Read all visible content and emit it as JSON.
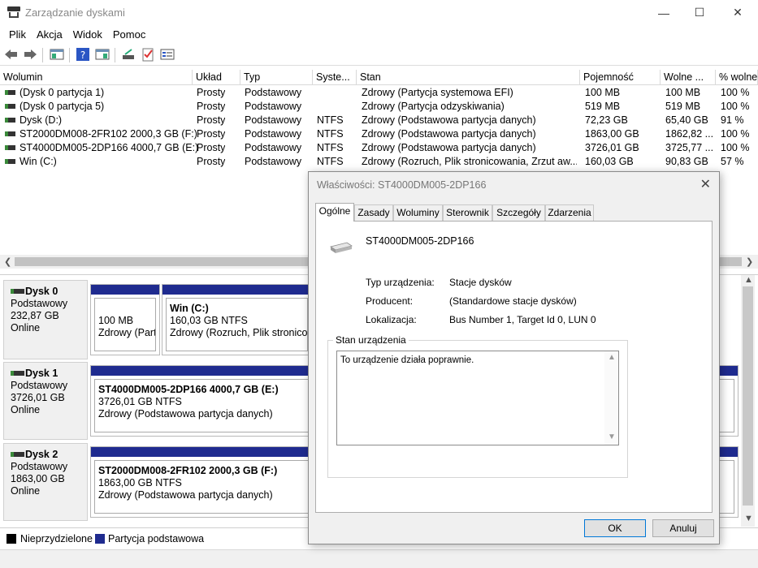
{
  "window": {
    "title": "Zarządzanie dyskami"
  },
  "menu": [
    "Plik",
    "Akcja",
    "Widok",
    "Pomoc"
  ],
  "volumes": {
    "columns": [
      "Wolumin",
      "Układ",
      "Typ",
      "Syste...",
      "Stan",
      "Pojemność",
      "Wolne ...",
      "% wolne"
    ],
    "rows": [
      [
        "(Dysk 0 partycja 1)",
        "Prosty",
        "Podstawowy",
        "",
        "Zdrowy (Partycja systemowa EFI)",
        "100 MB",
        "100 MB",
        "100 %"
      ],
      [
        "(Dysk 0 partycja 5)",
        "Prosty",
        "Podstawowy",
        "",
        "Zdrowy (Partycja odzyskiwania)",
        "519 MB",
        "519 MB",
        "100 %"
      ],
      [
        "Dysk (D:)",
        "Prosty",
        "Podstawowy",
        "NTFS",
        "Zdrowy (Podstawowa partycja danych)",
        "72,23 GB",
        "65,40 GB",
        "91 %"
      ],
      [
        "ST2000DM008-2FR102 2000,3 GB (F:)",
        "Prosty",
        "Podstawowy",
        "NTFS",
        "Zdrowy (Podstawowa partycja danych)",
        "1863,00 GB",
        "1862,82 ...",
        "100 %"
      ],
      [
        "ST4000DM005-2DP166 4000,7 GB (E:)",
        "Prosty",
        "Podstawowy",
        "NTFS",
        "Zdrowy (Podstawowa partycja danych)",
        "3726,01 GB",
        "3725,77 ...",
        "100 %"
      ],
      [
        "Win (C:)",
        "Prosty",
        "Podstawowy",
        "NTFS",
        "Zdrowy (Rozruch, Plik stronicowania, Zrzut aw...",
        "160,03 GB",
        "90,83 GB",
        "57 %"
      ]
    ]
  },
  "disks": [
    {
      "name": "Dysk 0",
      "type": "Podstawowy",
      "size": "232,87 GB",
      "status": "Online",
      "partitions": [
        {
          "title": "",
          "line1": "100 MB",
          "line2": "Zdrowy (Part"
        },
        {
          "title": "Win  (C:)",
          "line1": "160,03 GB NTFS",
          "line2": "Zdrowy (Rozruch, Plik stronicow"
        }
      ]
    },
    {
      "name": "Dysk 1",
      "type": "Podstawowy",
      "size": "3726,01 GB",
      "status": "Online",
      "partitions": [
        {
          "title": "ST4000DM005-2DP166 4000,7 GB  (E:)",
          "line1": "3726,01 GB NTFS",
          "line2": "Zdrowy (Podstawowa partycja danych)"
        }
      ]
    },
    {
      "name": "Dysk 2",
      "type": "Podstawowy",
      "size": "1863,00 GB",
      "status": "Online",
      "partitions": [
        {
          "title": "ST2000DM008-2FR102 2000,3 GB  (F:)",
          "line1": "1863,00 GB NTFS",
          "line2": "Zdrowy (Podstawowa partycja danych)"
        }
      ]
    }
  ],
  "legend": {
    "unallocated": "Nieprzydzielone",
    "primary": "Partycja podstawowa",
    "unallocated_color": "#000000",
    "primary_color": "#1f2b8f"
  },
  "dialog": {
    "title": "Właściwości: ST4000DM005-2DP166",
    "tabs": [
      "Ogólne",
      "Zasady",
      "Woluminy",
      "Sterownik",
      "Szczegóły",
      "Zdarzenia"
    ],
    "device_name": "ST4000DM005-2DP166",
    "props": [
      {
        "label": "Typ urządzenia:",
        "value": "Stacje dysków"
      },
      {
        "label": "Producent:",
        "value": "(Standardowe stacje dysków)"
      },
      {
        "label": "Lokalizacja:",
        "value": "Bus Number 1, Target Id 0, LUN 0"
      }
    ],
    "status_group": "Stan urządzenia",
    "status_text": "To urządzenie działa poprawnie.",
    "ok": "OK",
    "cancel": "Anuluj"
  }
}
